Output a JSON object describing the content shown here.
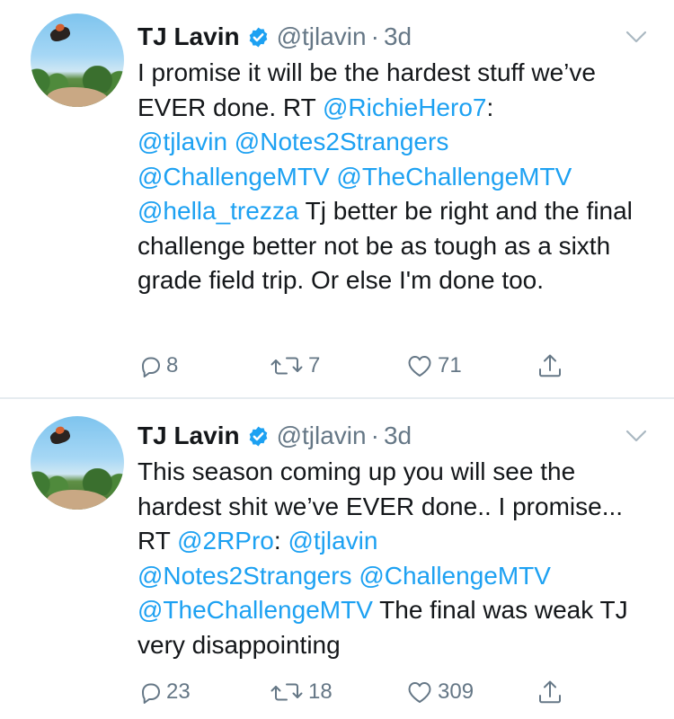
{
  "tweets": [
    {
      "author": {
        "name": "TJ Lavin",
        "handle": "@tjlavin",
        "separator": "·",
        "time": "3d"
      },
      "body": [
        {
          "text": "I promise it will be the hardest stuff we’ve EVER done. RT ",
          "type": "text"
        },
        {
          "text": "@RichieHero7",
          "type": "mention"
        },
        {
          "text": ": ",
          "type": "text"
        },
        {
          "text": "@tjlavin",
          "type": "mention"
        },
        {
          "text": " ",
          "type": "text"
        },
        {
          "text": "@Notes2Strangers",
          "type": "mention"
        },
        {
          "text": " ",
          "type": "text"
        },
        {
          "text": "@ChallengeMTV",
          "type": "mention"
        },
        {
          "text": " ",
          "type": "text"
        },
        {
          "text": "@TheChallengeMTV",
          "type": "mention"
        },
        {
          "text": " ",
          "type": "text"
        },
        {
          "text": "@hella_trezza",
          "type": "mention"
        },
        {
          "text": " Tj better be right and the final challenge better not be as tough as a sixth grade field trip. Or else I'm done too.",
          "type": "text"
        }
      ],
      "counts": {
        "replies": "8",
        "retweets": "7",
        "likes": "71"
      }
    },
    {
      "author": {
        "name": "TJ Lavin",
        "handle": "@tjlavin",
        "separator": "·",
        "time": "3d"
      },
      "body": [
        {
          "text": "This season coming up you will see the hardest shit we’ve EVER done.. I promise... RT ",
          "type": "text"
        },
        {
          "text": "@2RPro",
          "type": "mention"
        },
        {
          "text": ": ",
          "type": "text"
        },
        {
          "text": "@tjlavin",
          "type": "mention"
        },
        {
          "text": " ",
          "type": "text"
        },
        {
          "text": "@Notes2Strangers",
          "type": "mention"
        },
        {
          "text": " ",
          "type": "text"
        },
        {
          "text": "@ChallengeMTV",
          "type": "mention"
        },
        {
          "text": " ",
          "type": "text"
        },
        {
          "text": "@TheChallengeMTV",
          "type": "mention"
        },
        {
          "text": " The final was weak TJ very disappointing",
          "type": "text"
        }
      ],
      "counts": {
        "replies": "23",
        "retweets": "18",
        "likes": "309"
      }
    }
  ],
  "icons": {
    "verified": "verified-badge-icon",
    "menu": "chevron-down-icon",
    "reply": "reply-icon",
    "retweet": "retweet-icon",
    "like": "heart-icon",
    "share": "share-icon"
  },
  "colors": {
    "text": "#14171a",
    "secondary": "#657786",
    "link": "#1da1f2",
    "divider": "#e6ecf0"
  }
}
